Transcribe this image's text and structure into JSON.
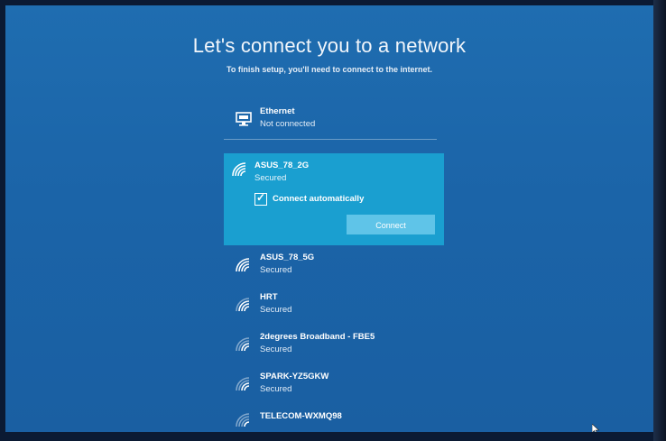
{
  "header": {
    "title": "Let's connect you to a network",
    "subtitle": "To finish setup, you'll need to connect to the internet."
  },
  "ethernet": {
    "icon": "ethernet-icon",
    "name": "Ethernet",
    "status": "Not connected"
  },
  "selected_network": {
    "icon": "wifi-icon",
    "name": "ASUS_78_2G",
    "status": "Secured",
    "connect_automatically_label": "Connect automatically",
    "connect_automatically_checked": true,
    "connect_label": "Connect"
  },
  "networks": [
    {
      "icon": "wifi-icon",
      "name": "ASUS_78_5G",
      "status": "Secured"
    },
    {
      "icon": "wifi-icon",
      "name": "HRT",
      "status": "Secured"
    },
    {
      "icon": "wifi-icon",
      "name": "2degrees Broadband - FBE5",
      "status": "Secured"
    },
    {
      "icon": "wifi-icon",
      "name": "SPARK-YZ5GKW",
      "status": "Secured"
    },
    {
      "icon": "wifi-icon",
      "name": "TELECOM-WXMQ98",
      "status": ""
    }
  ],
  "colors": {
    "background": "#1b64a8",
    "selected": "#1a9fd0",
    "button": "#5fc4e8",
    "text": "#ffffff"
  }
}
